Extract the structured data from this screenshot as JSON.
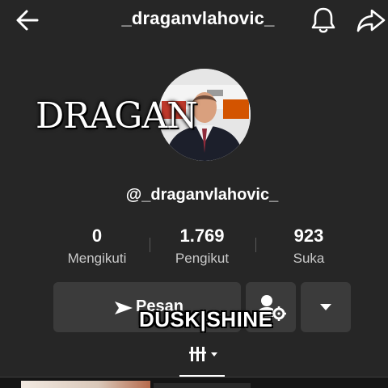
{
  "header": {
    "title": "_draganvlahovic_",
    "back_icon": "arrow-left-icon",
    "bell_icon": "bell-icon",
    "share_icon": "share-arrow-icon"
  },
  "profile": {
    "overlay_name": "DRAGAN",
    "handle": "@_draganvlahovic_"
  },
  "stats": [
    {
      "value": "0",
      "label": "Mengikuti"
    },
    {
      "value": "1.769",
      "label": "Pengikut"
    },
    {
      "value": "923",
      "label": "Suka"
    }
  ],
  "buttons": {
    "message_label": "Pesan",
    "message_icon": "paper-plane-icon",
    "friend_icon": "person-gear-icon",
    "more_icon": "caret-down-icon"
  },
  "watermark": "DUSK|SHINE",
  "tabs": {
    "grid_icon": "grid-columns-icon"
  },
  "colors": {
    "background": "#262626",
    "button": "#3b3b3b",
    "text": "#ffffff",
    "muted_text": "#c9c9c9"
  }
}
